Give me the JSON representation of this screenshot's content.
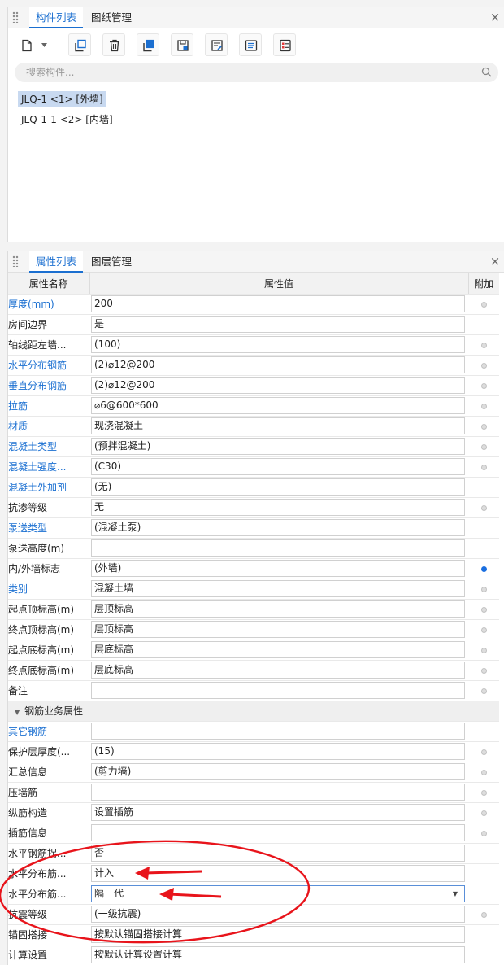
{
  "top_panel": {
    "tabs": [
      {
        "label": "构件列表"
      },
      {
        "label": "图纸管理"
      }
    ],
    "close": "×",
    "search_placeholder": "搜索构件...",
    "components": [
      {
        "label": "JLQ-1 <1> [外墙]"
      },
      {
        "label": "JLQ-1-1 <2> [内墙]"
      }
    ]
  },
  "bottom_panel": {
    "tabs": [
      {
        "label": "属性列表"
      },
      {
        "label": "图层管理"
      }
    ],
    "close": "×",
    "columns": {
      "name": "属性名称",
      "value": "属性值",
      "extra": "附加"
    },
    "rows": [
      {
        "name": "厚度(mm)",
        "value": "200"
      },
      {
        "name": "房间边界",
        "value": "是"
      },
      {
        "name": "轴线距左墙...",
        "value": "(100)"
      },
      {
        "name": "水平分布钢筋",
        "value": "(2)⌀12@200"
      },
      {
        "name": "垂直分布钢筋",
        "value": "(2)⌀12@200"
      },
      {
        "name": "拉筋",
        "value": "⌀6@600*600"
      },
      {
        "name": "材质",
        "value": "现浇混凝土"
      },
      {
        "name": "混凝土类型",
        "value": "(预拌混凝土)"
      },
      {
        "name": "混凝土强度...",
        "value": "(C30)"
      },
      {
        "name": "混凝土外加剂",
        "value": "(无)"
      },
      {
        "name": "抗渗等级",
        "value": "无"
      },
      {
        "name": "泵送类型",
        "value": "(混凝土泵)"
      },
      {
        "name": "泵送高度(m)",
        "value": ""
      },
      {
        "name": "内/外墙标志",
        "value": "(外墙)"
      },
      {
        "name": "类别",
        "value": "混凝土墙"
      },
      {
        "name": "起点顶标高(m)",
        "value": "层顶标高"
      },
      {
        "name": "终点顶标高(m)",
        "value": "层顶标高"
      },
      {
        "name": "起点底标高(m)",
        "value": "层底标高"
      },
      {
        "name": "终点底标高(m)",
        "value": "层底标高"
      },
      {
        "name": "备注",
        "value": ""
      }
    ],
    "group": {
      "label": "钢筋业务属性"
    },
    "rebar_rows": [
      {
        "name": "其它钢筋",
        "value": ""
      },
      {
        "name": "保护层厚度(...",
        "value": "(15)"
      },
      {
        "name": "汇总信息",
        "value": "(剪力墙)"
      },
      {
        "name": "压墙筋",
        "value": ""
      },
      {
        "name": "纵筋构造",
        "value": "设置插筋"
      },
      {
        "name": "插筋信息",
        "value": ""
      },
      {
        "name": "水平钢筋拐...",
        "value": "否"
      },
      {
        "name": "水平分布筋...",
        "value": "计入"
      },
      {
        "name": "水平分布筋...",
        "value": "隔一代一"
      },
      {
        "name": "抗震等级",
        "value": "(一级抗震)"
      },
      {
        "name": "锚固搭接",
        "value": "按默认锚固搭接计算"
      },
      {
        "name": "计算设置",
        "value": "按默认计算设置计算"
      }
    ]
  },
  "colors": {
    "accent": "#1b6fd0",
    "link_name": "#1a6fd1",
    "selected_bg": "#c8d9f0",
    "annotation_red": "#e8141b",
    "dot_on": "#1b6fe0"
  }
}
